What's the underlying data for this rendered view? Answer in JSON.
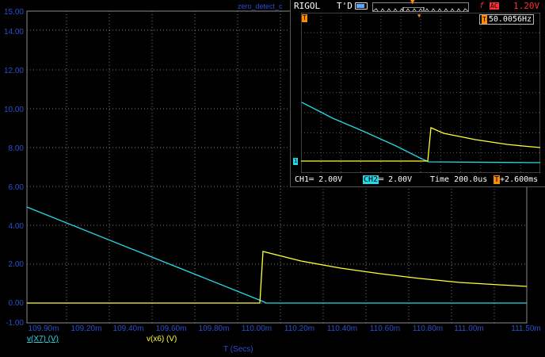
{
  "sim": {
    "title": "zero_detect_c",
    "y_ticks": [
      "15.00",
      "14.00",
      "12.00",
      "10.00",
      "8.00",
      "6.00",
      "4.00",
      "2.00",
      "0.00",
      "-1.00"
    ],
    "x_ticks": [
      "109.90m",
      "109.20m",
      "109.40m",
      "109.60m",
      "109.80m",
      "110.00m",
      "110.20m",
      "110.40m",
      "110.60m",
      "110.80m",
      "111.00m",
      "111.50m"
    ],
    "legend": [
      {
        "label": "v(X7) (V)",
        "color": "#27d7e6"
      },
      {
        "label": "v(x6) (V)",
        "color": "#ffff33"
      }
    ],
    "xlabel": "T (Secs)"
  },
  "scope": {
    "brand": "RIGOL",
    "trig_state": "T'D",
    "trigger_source": "f",
    "coupling": "AC",
    "trigger_level": "1.20V",
    "frequency_tag": "T",
    "frequency": "50.0056Hz",
    "top_trigger_marker": "T",
    "ch1_marker": "1",
    "ch1_label": "CH1═ 2.00V",
    "ch2_tag": "CH2",
    "ch2_label": "═ 2.00V",
    "time_label": "Time 200.0us",
    "time_pos_tag": "T",
    "time_pos": "+2.600ms"
  },
  "colors": {
    "cyan": "#27d7e6",
    "yellow": "#ffff33",
    "axis_text": "#2a4fd0",
    "grid": "#7a7a7a",
    "trigger": "#ff3030",
    "orange": "#ff8a00"
  }
}
